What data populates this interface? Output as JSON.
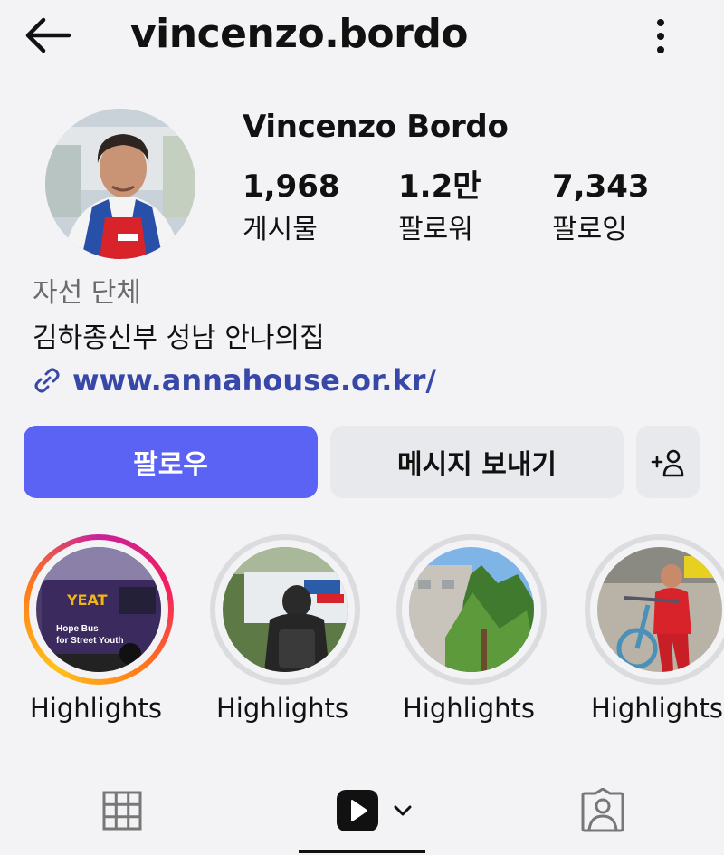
{
  "header": {
    "username": "vincenzo.bordo",
    "back_icon": "arrow-left-icon",
    "more_icon": "more-vertical-icon"
  },
  "profile": {
    "full_name": "Vincenzo Bordo",
    "avatar_icon": "avatar",
    "stats": [
      {
        "value": "1,968",
        "label": "게시물"
      },
      {
        "value": "1.2만",
        "label": "팔로워"
      },
      {
        "value": "7,343",
        "label": "팔로잉"
      }
    ],
    "category": "자선 단체",
    "bio": "김하종신부 성남 안나의집",
    "link": "www.annahouse.or.kr/"
  },
  "actions": {
    "follow_label": "팔로우",
    "message_label": "메시지 보내기",
    "add_user_icon": "add-user-icon",
    "follow_color": "#5b63f5"
  },
  "highlights": [
    {
      "label": "Highlights",
      "caption_line1": "Hope Bus",
      "caption_line2": "for Street Youth",
      "active": true
    },
    {
      "label": "Highlights",
      "active": false
    },
    {
      "label": "Highlights",
      "active": false
    },
    {
      "label": "Highlights",
      "active": false
    }
  ],
  "tabs": [
    {
      "icon": "grid-icon"
    },
    {
      "icon": "reels-icon",
      "selected": true
    },
    {
      "icon": "tagged-icon"
    }
  ]
}
